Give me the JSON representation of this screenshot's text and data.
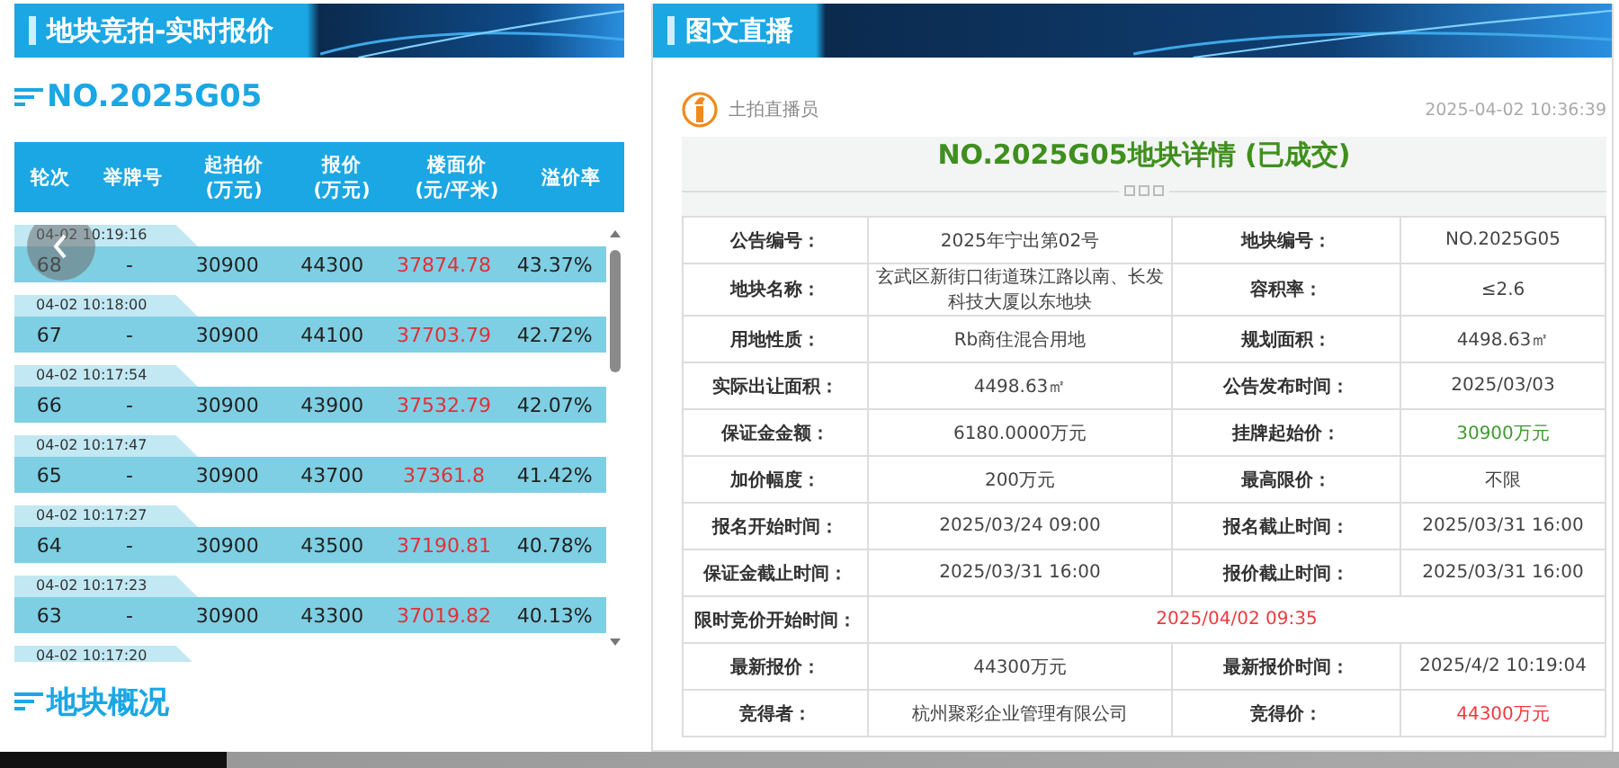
{
  "left_panel": {
    "header": "地块竞拍-实时报价",
    "lot_title": "NO.2025G05",
    "columns": [
      {
        "lines": [
          "轮次"
        ]
      },
      {
        "lines": [
          "举牌号"
        ]
      },
      {
        "lines": [
          "起拍价",
          "(万元)"
        ]
      },
      {
        "lines": [
          "报价",
          "(万元)"
        ]
      },
      {
        "lines": [
          "楼面价",
          "(元/平米)"
        ]
      },
      {
        "lines": [
          "溢价率"
        ]
      }
    ],
    "rows": [
      {
        "time": "04-02 10:19:16",
        "cells": [
          "68",
          "-",
          "30900",
          "44300",
          "37874.78",
          "43.37%"
        ]
      },
      {
        "time": "04-02 10:18:00",
        "cells": [
          "67",
          "-",
          "30900",
          "44100",
          "37703.79",
          "42.72%"
        ]
      },
      {
        "time": "04-02 10:17:54",
        "cells": [
          "66",
          "-",
          "30900",
          "43900",
          "37532.79",
          "42.07%"
        ]
      },
      {
        "time": "04-02 10:17:47",
        "cells": [
          "65",
          "-",
          "30900",
          "43700",
          "37361.8",
          "41.42%"
        ]
      },
      {
        "time": "04-02 10:17:27",
        "cells": [
          "64",
          "-",
          "30900",
          "43500",
          "37190.81",
          "40.78%"
        ]
      },
      {
        "time": "04-02 10:17:23",
        "cells": [
          "63",
          "-",
          "30900",
          "43300",
          "37019.82",
          "40.13%"
        ]
      },
      {
        "time": "04-02 10:17:20"
      }
    ],
    "section_title": "地块概况"
  },
  "right_panel": {
    "header": "图文直播",
    "author": "土拍直播员",
    "timestamp": "2025-04-02 10:36:39",
    "title": "NO.2025G05地块详情 (已成交)",
    "detail_rows": [
      [
        {
          "kind": "label",
          "text": "公告编号："
        },
        {
          "kind": "value",
          "text": "2025年宁出第02号"
        },
        {
          "kind": "label",
          "text": "地块编号："
        },
        {
          "kind": "value",
          "text": "NO.2025G05"
        }
      ],
      [
        {
          "kind": "label",
          "text": "地块名称："
        },
        {
          "kind": "value",
          "text": "玄武区新街口街道珠江路以南、长发科技大厦以东地块"
        },
        {
          "kind": "label",
          "text": "容积率："
        },
        {
          "kind": "value",
          "text": "≤2.6"
        }
      ],
      [
        {
          "kind": "label",
          "text": "用地性质："
        },
        {
          "kind": "value",
          "text": "Rb商住混合用地"
        },
        {
          "kind": "label",
          "text": "规划面积："
        },
        {
          "kind": "value",
          "text": "4498.63㎡"
        }
      ],
      [
        {
          "kind": "label",
          "text": "实际出让面积："
        },
        {
          "kind": "value",
          "text": "4498.63㎡"
        },
        {
          "kind": "label",
          "text": "公告发布时间："
        },
        {
          "kind": "value",
          "text": "2025/03/03"
        }
      ],
      [
        {
          "kind": "label",
          "text": "保证金金额："
        },
        {
          "kind": "value",
          "text": "6180.0000万元"
        },
        {
          "kind": "label",
          "text": "挂牌起始价："
        },
        {
          "kind": "value",
          "text": "30900万元",
          "color": "#3f9a2e"
        }
      ],
      [
        {
          "kind": "label",
          "text": "加价幅度："
        },
        {
          "kind": "value",
          "text": "200万元"
        },
        {
          "kind": "label",
          "text": "最高限价："
        },
        {
          "kind": "value",
          "text": "不限"
        }
      ],
      [
        {
          "kind": "label",
          "text": "报名开始时间："
        },
        {
          "kind": "value",
          "text": "2025/03/24 09:00"
        },
        {
          "kind": "label",
          "text": "报名截止时间："
        },
        {
          "kind": "value",
          "text": "2025/03/31 16:00"
        }
      ],
      [
        {
          "kind": "label",
          "text": "保证金截止时间："
        },
        {
          "kind": "value",
          "text": "2025/03/31 16:00"
        },
        {
          "kind": "label",
          "text": "报价截止时间："
        },
        {
          "kind": "value",
          "text": "2025/03/31 16:00"
        }
      ],
      [
        {
          "kind": "label",
          "text": "限时竞价开始时间："
        },
        {
          "kind": "value",
          "text": "2025/04/02 09:35",
          "color": "#f0383d"
        }
      ],
      [
        {
          "kind": "label",
          "text": "最新报价："
        },
        {
          "kind": "value",
          "text": "44300万元"
        },
        {
          "kind": "label",
          "text": "最新报价时间："
        },
        {
          "kind": "value",
          "text": "2025/4/2 10:19:04"
        }
      ],
      [
        {
          "kind": "label",
          "text": "竞得者："
        },
        {
          "kind": "value",
          "text": "杭州聚彩企业管理有限公司"
        },
        {
          "kind": "label",
          "text": "竞得价："
        },
        {
          "kind": "value",
          "text": "44300万元",
          "color": "#f0383d"
        }
      ]
    ]
  }
}
